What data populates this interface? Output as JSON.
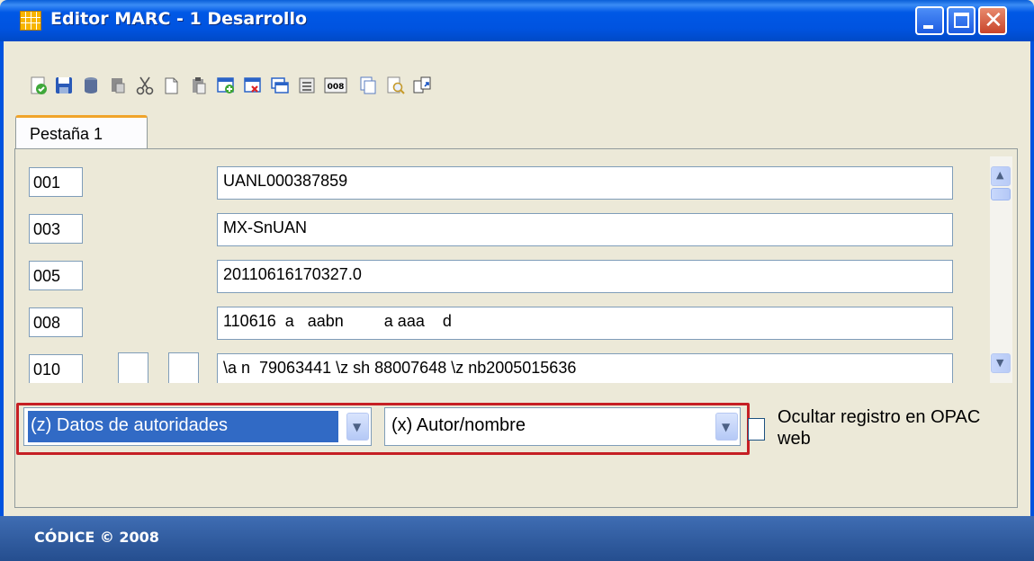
{
  "window": {
    "title": "Editor MARC - 1 Desarrollo",
    "controls": [
      "minimize",
      "maximize",
      "close"
    ]
  },
  "toolbar": {
    "buttons": [
      {
        "name": "validate-icon"
      },
      {
        "name": "save-icon"
      },
      {
        "name": "database-icon"
      },
      {
        "name": "stamp-icon"
      },
      {
        "name": "cut-icon"
      },
      {
        "name": "copy-icon"
      },
      {
        "name": "paste-icon"
      },
      {
        "name": "add-field-icon"
      },
      {
        "name": "delete-field-icon"
      },
      {
        "name": "duplicate-field-icon"
      },
      {
        "name": "field-list-icon"
      },
      {
        "name": "field-008-icon",
        "label": "008"
      },
      {
        "name": "copy-record-icon"
      },
      {
        "name": "preview-icon"
      },
      {
        "name": "export-icon"
      }
    ]
  },
  "tabs": [
    {
      "label": "Pestaña 1"
    }
  ],
  "fields": [
    {
      "tag": "001",
      "ind1": "",
      "ind2": "",
      "value": "UANL000387859"
    },
    {
      "tag": "003",
      "ind1": "",
      "ind2": "",
      "value": "MX-SnUAN"
    },
    {
      "tag": "005",
      "ind1": "",
      "ind2": "",
      "value": "20110616170327.0"
    },
    {
      "tag": "008",
      "ind1": "",
      "ind2": "",
      "value": "110616  a   aabn         a aaa    d"
    },
    {
      "tag": "010",
      "ind1": "",
      "ind2": "",
      "value": "\\a n  79063441 \\z sh 88007648 \\z nb2005015636"
    }
  ],
  "selectors": {
    "authority_type": "(z) Datos de autoridades",
    "field_type": "(x) Autor/nombre",
    "hide_opac_label": "Ocultar registro en OPAC web",
    "hide_opac_checked": false
  },
  "footer": {
    "text": "CÓDICE © 2008"
  },
  "colors": {
    "titlebar": "#0053df",
    "selection": "#316ac5",
    "highlight": "#c51f24",
    "footer": "#254e8f"
  }
}
